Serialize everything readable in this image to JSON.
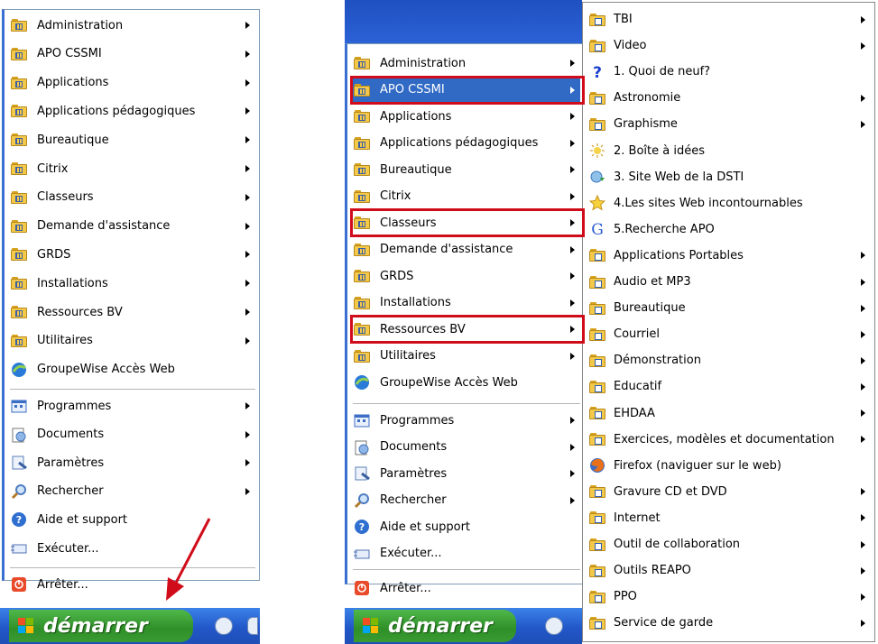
{
  "left_menu": {
    "top_items": [
      {
        "label": "Administration",
        "icon": "program-group-icon",
        "submenu": true
      },
      {
        "label": "APO CSSMI",
        "icon": "program-group-icon",
        "submenu": true
      },
      {
        "label": "Applications",
        "icon": "program-group-icon",
        "submenu": true
      },
      {
        "label": "Applications pédagogiques",
        "icon": "program-group-icon",
        "submenu": true
      },
      {
        "label": "Bureautique",
        "icon": "program-group-icon",
        "submenu": true
      },
      {
        "label": "Citrix",
        "icon": "program-group-icon",
        "submenu": true
      },
      {
        "label": "Classeurs",
        "icon": "program-group-icon",
        "submenu": true
      },
      {
        "label": "Demande d'assistance",
        "icon": "program-group-icon",
        "submenu": true
      },
      {
        "label": "GRDS",
        "icon": "program-group-icon",
        "submenu": true
      },
      {
        "label": "Installations",
        "icon": "program-group-icon",
        "submenu": true
      },
      {
        "label": "Ressources BV",
        "icon": "program-group-icon",
        "submenu": true
      },
      {
        "label": "Utilitaires",
        "icon": "program-group-icon",
        "submenu": true
      },
      {
        "label": "GroupeWise Accès Web",
        "icon": "browser-icon",
        "submenu": false
      }
    ],
    "system_items": [
      {
        "label": "Programmes",
        "icon": "programs-icon",
        "submenu": true
      },
      {
        "label": "Documents",
        "icon": "documents-icon",
        "submenu": true
      },
      {
        "label": "Paramètres",
        "icon": "settings-icon",
        "submenu": true
      },
      {
        "label": "Rechercher",
        "icon": "search-icon",
        "submenu": true
      },
      {
        "label": "Aide et support",
        "icon": "help-icon",
        "submenu": false
      },
      {
        "label": "Exécuter...",
        "icon": "run-icon",
        "submenu": false
      }
    ],
    "shutdown": {
      "label": "Arrêter...",
      "icon": "shutdown-icon"
    }
  },
  "mid_menu": {
    "top_items": [
      {
        "label": "Administration",
        "submenu": true
      },
      {
        "label": "APO CSSMI",
        "submenu": true,
        "highlighted": true,
        "boxed": true
      },
      {
        "label": "Applications",
        "submenu": true
      },
      {
        "label": "Applications pédagogiques",
        "submenu": true
      },
      {
        "label": "Bureautique",
        "submenu": true
      },
      {
        "label": "Citrix",
        "submenu": true
      },
      {
        "label": "Classeurs",
        "submenu": true,
        "boxed": true
      },
      {
        "label": "Demande d'assistance",
        "submenu": true
      },
      {
        "label": "GRDS",
        "submenu": true
      },
      {
        "label": "Installations",
        "submenu": true
      },
      {
        "label": "Ressources BV",
        "submenu": true,
        "boxed": true
      },
      {
        "label": "Utilitaires",
        "submenu": true
      },
      {
        "label": "GroupeWise Accès Web",
        "submenu": false
      }
    ],
    "system_items": [
      {
        "label": "Programmes",
        "submenu": true
      },
      {
        "label": "Documents",
        "submenu": true
      },
      {
        "label": "Paramètres",
        "submenu": true
      },
      {
        "label": "Rechercher",
        "submenu": true
      },
      {
        "label": "Aide et support",
        "submenu": false
      },
      {
        "label": "Exécuter...",
        "submenu": false
      }
    ],
    "shutdown": {
      "label": "Arrêter..."
    }
  },
  "submenu": {
    "items": [
      {
        "label": "TBI",
        "icon": "folder-icon",
        "submenu": true
      },
      {
        "label": "Video",
        "icon": "folder-icon",
        "submenu": true
      },
      {
        "label": "1. Quoi de neuf?",
        "icon": "question-icon",
        "submenu": false
      },
      {
        "label": "Astronomie",
        "icon": "folder-icon",
        "submenu": true
      },
      {
        "label": "Graphisme",
        "icon": "folder-icon",
        "submenu": true
      },
      {
        "label": "2. Boîte à idées",
        "icon": "idea-icon",
        "submenu": false
      },
      {
        "label": "3. Site Web de la DSTI",
        "icon": "web-link-icon",
        "submenu": false
      },
      {
        "label": "4.Les sites Web incontournables",
        "icon": "star-icon",
        "submenu": false
      },
      {
        "label": "5.Recherche APO",
        "icon": "google-icon",
        "submenu": false
      },
      {
        "label": "Applications Portables",
        "icon": "folder-icon",
        "submenu": true
      },
      {
        "label": "Audio et MP3",
        "icon": "folder-icon",
        "submenu": true
      },
      {
        "label": "Bureautique",
        "icon": "folder-icon",
        "submenu": true
      },
      {
        "label": "Courriel",
        "icon": "folder-icon",
        "submenu": true
      },
      {
        "label": "Démonstration",
        "icon": "folder-icon",
        "submenu": true
      },
      {
        "label": "Educatif",
        "icon": "folder-icon",
        "submenu": true
      },
      {
        "label": "EHDAA",
        "icon": "folder-icon",
        "submenu": true
      },
      {
        "label": "Exercices, modèles et documentation",
        "icon": "folder-icon",
        "submenu": true
      },
      {
        "label": "Firefox (naviguer sur le web)",
        "icon": "firefox-icon",
        "submenu": false
      },
      {
        "label": "Gravure CD et DVD",
        "icon": "folder-icon",
        "submenu": true
      },
      {
        "label": "Internet",
        "icon": "folder-icon",
        "submenu": true
      },
      {
        "label": "Outil de collaboration",
        "icon": "folder-icon",
        "submenu": true
      },
      {
        "label": "Outils REAPO",
        "icon": "folder-icon",
        "submenu": true
      },
      {
        "label": "PPO",
        "icon": "folder-icon",
        "submenu": true
      },
      {
        "label": "Service de garde",
        "icon": "folder-icon",
        "submenu": true
      }
    ]
  },
  "taskbar": {
    "start_label": "démarrer"
  },
  "colors": {
    "highlight": "#316ac5",
    "annotation_red": "#d10c1a",
    "taskbar_blue": "#2257c9",
    "start_green": "#3a9b33"
  }
}
